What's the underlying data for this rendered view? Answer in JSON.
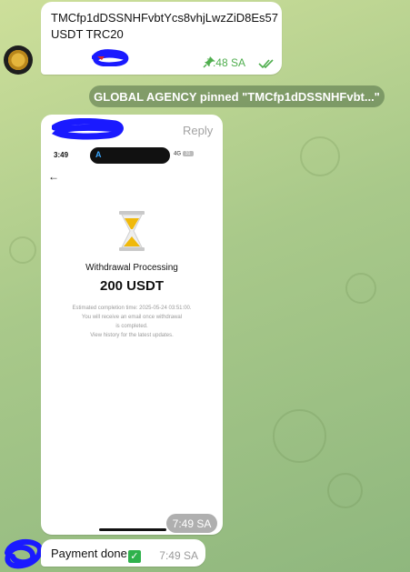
{
  "message_1": {
    "line1": "TMCfp1dDSSNHFvbtYcs8vhjLwzZiD8Es57",
    "line2": "USDT TRC20",
    "time": "7:48 SA",
    "icons": [
      "pin-icon",
      "double-check-icon"
    ]
  },
  "service_message": "GLOBAL AGENCY pinned \"TMCfp1dDSSNHFvbt...\"",
  "photo_message": {
    "reply_label": "Reply",
    "time": "7:49 SA",
    "screenshot": {
      "clock": "3:49",
      "island_letter": "A",
      "network": "4G",
      "battery": "31",
      "title": "Withdrawal Processing",
      "amount": "200 USDT",
      "note_line1": "Estimated completion time: 2025-05-24 03:51:00.",
      "note_line2": "You will receive an email once withdrawal",
      "note_line3": "is completed.",
      "note_line4": "View history for the latest updates."
    }
  },
  "message_2": {
    "text": "Payment done",
    "time": "7:49 SA"
  },
  "colors": {
    "read_ticks": "#4fae4e",
    "hourglass_sand": "#f0b90b",
    "scribble": "#1a1aff"
  }
}
